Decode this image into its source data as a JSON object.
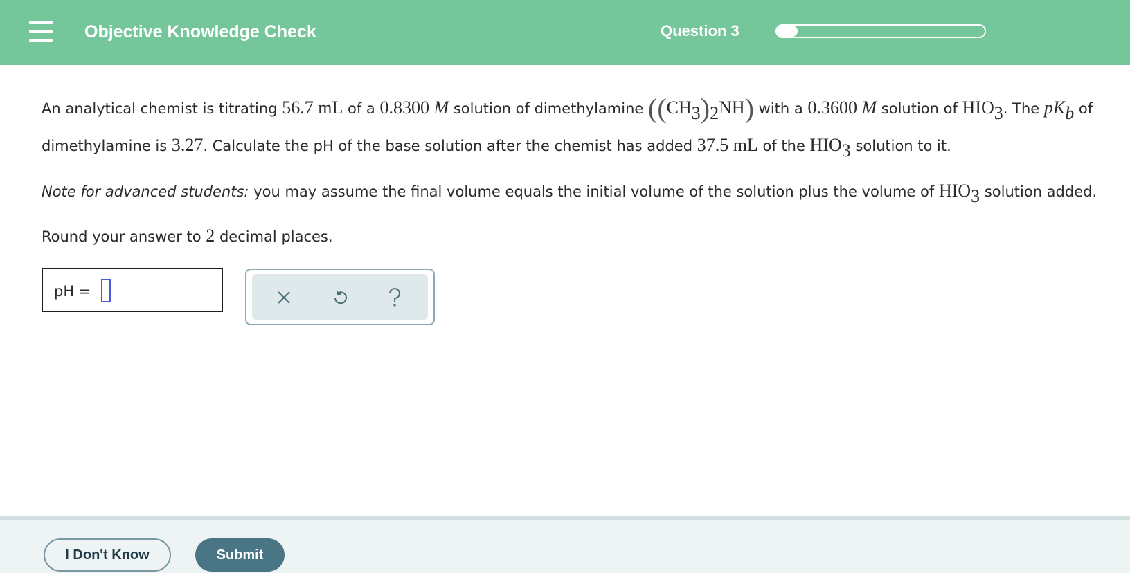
{
  "header": {
    "title": "Objective Knowledge Check",
    "question_label": "Question 3",
    "progress": 0.1,
    "color": "#75c69a"
  },
  "question": {
    "p1": {
      "t1": "An analytical chemist is titrating ",
      "m1": "56.7 mL",
      "t2": " of a ",
      "m2": "0.8300",
      "m2b": "M",
      "t3": " solution of dimethylamine ",
      "formula_ch": "CH",
      "formula_3": "3",
      "formula_2": "2",
      "formula_nh": "NH",
      "t4": " with a ",
      "m3": "0.3600",
      "m3b": "M",
      "t5": " solution of ",
      "hio": "HIO",
      "hio_sub": "3",
      "t6": ". The ",
      "pk_p": "p",
      "pk_k": "K",
      "pk_b": "b",
      "t7": " of"
    },
    "p1b": {
      "t1": "dimethylamine is ",
      "m1": "3.27",
      "t2": ". Calculate the pH of the base solution after the chemist has added ",
      "m2": "37.5 mL",
      "t3": " of the ",
      "hio": "HIO",
      "hio_sub": "3",
      "t4": " solution to it."
    },
    "p2": {
      "note_label": "Note for advanced students:",
      "t1": " you may assume the final volume equals the initial volume of the solution plus the volume of ",
      "hio": "HIO",
      "hio_sub": "3",
      "t2": " solution added."
    },
    "p3": {
      "t1": "Round your answer to ",
      "m1": "2",
      "t2": " decimal places."
    }
  },
  "answer": {
    "label": "pH  =",
    "value": ""
  },
  "tools": {
    "clear_icon": "x-icon",
    "undo_icon": "undo-icon",
    "help_icon": "help-icon"
  },
  "footer": {
    "dont_know_label": "I Don't Know",
    "submit_label": "Submit"
  }
}
